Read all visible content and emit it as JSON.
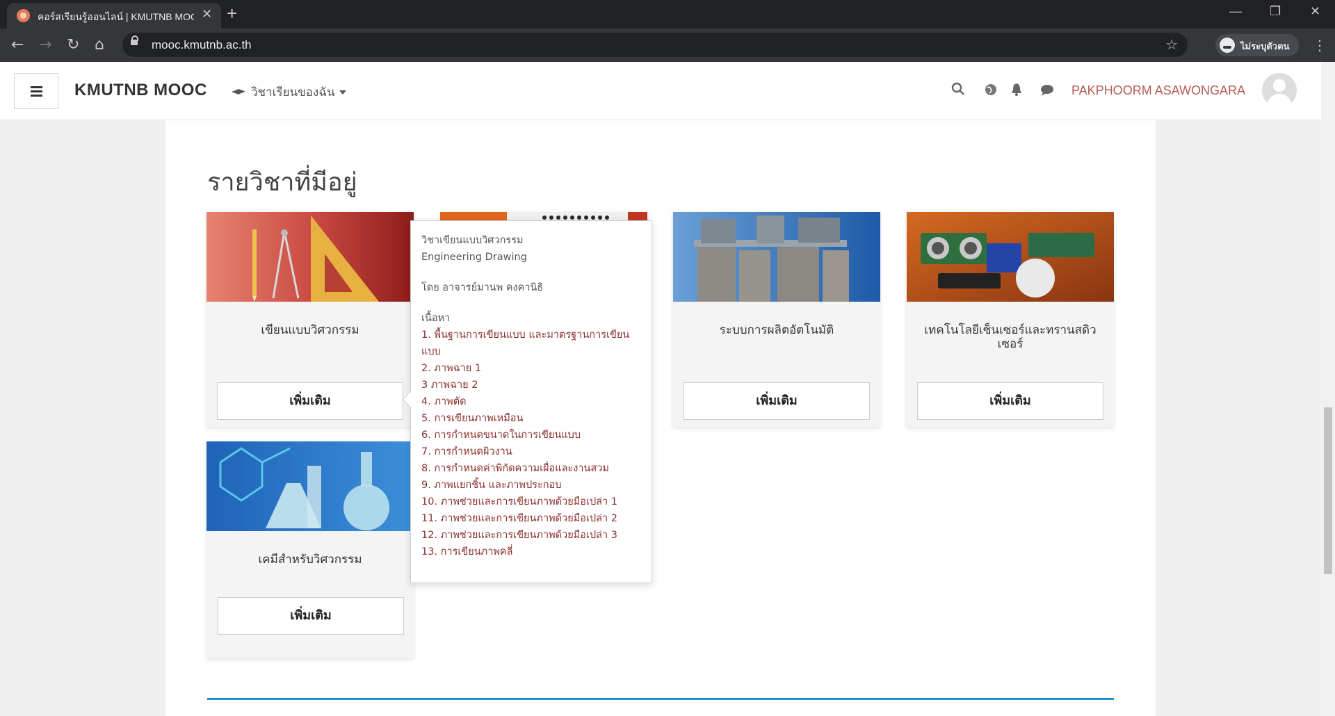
{
  "browser": {
    "tab_title": "คอร์สเรียนรู้ออนไลน์ | KMUTNB MOOC",
    "tab_close": "✕",
    "new_tab": "+",
    "url": "mooc.kmutnb.ac.th",
    "profile_label": "ไม่ระบุตัวตน",
    "window_controls": [
      "—",
      "❐",
      "✕"
    ]
  },
  "navbar": {
    "brand": "KMUTNB MOOC",
    "my_courses": "วิชาเรียนของฉัน",
    "username": "PAKPHOORM ASAWONGARA"
  },
  "main": {
    "heading": "รายวิชาที่มีอยู่",
    "courses": [
      {
        "title": "เขียนแบบวิศวกรรม",
        "button": "เพิ่มเติม"
      },
      {
        "title": "",
        "button": ""
      },
      {
        "title": "ระบบการผลิตอัตโนมัติ",
        "button": "เพิ่มเติม"
      },
      {
        "title": "เทคโนโลยีเซ็นเซอร์และทรานสดิวเซอร์",
        "button": "เพิ่มเติม"
      },
      {
        "title": "เคมีสำหรับวิศวกรรม",
        "button": "เพิ่มเติม"
      }
    ],
    "popover": {
      "title_th": "วิชาเขียนแบบวิศวกรรม",
      "title_en": "Engineering Drawing",
      "instructor": "โดย อาจารย์มานพ คงคานิธิ",
      "content_label": "เนื้อหา",
      "topics": [
        "1. พื้นฐานการเขียนแบบ และมาตรฐานการเขียนแบบ",
        "2. ภาพฉาย 1",
        "3 ภาพฉาย 2",
        "4. ภาพตัด",
        "5. การเขียนภาพเหมือน",
        "6. การกำหนดขนาดในการเขียนแบบ",
        "7. การกำหนดผิวงาน",
        "8. การกำหนดค่าพิกัดความเผื่อและงานสวม",
        "9. ภาพแยกชิ้น และภาพประกอบ",
        "10. ภาพช่วยและการเขียนภาพด้วยมือเปล่า 1",
        "11. ภาพช่วยและการเขียนภาพด้วยมือเปล่า 2",
        "12. ภาพช่วยและการเขียนภาพด้วยมือเปล่า 3",
        "13. การเขียนภาพคลี่"
      ]
    }
  },
  "colors": {
    "username": "#b45b56",
    "topic_link": "#8a2f2b",
    "accent_line": "#1f8fd6"
  }
}
